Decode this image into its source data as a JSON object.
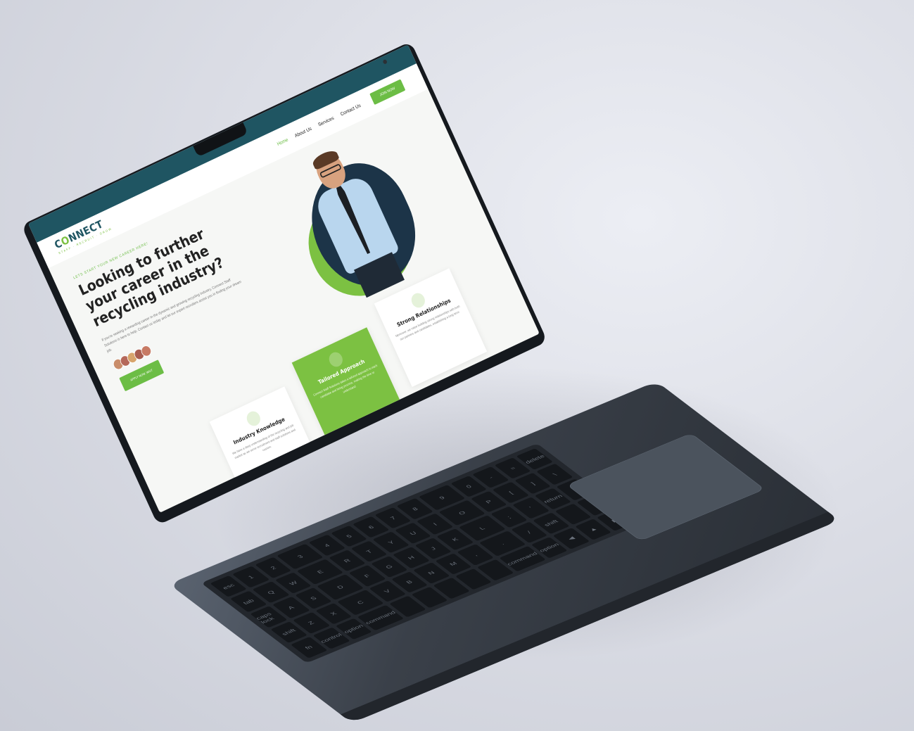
{
  "brand": {
    "name_prefix": "C",
    "name_o": "O",
    "name_suffix": "NNECT",
    "tagline": "STAFF · RECRUIT · GROW"
  },
  "nav": {
    "items": [
      {
        "label": "Home",
        "active": true
      },
      {
        "label": "About Us",
        "active": false
      },
      {
        "label": "Services",
        "active": false
      },
      {
        "label": "Contact Us",
        "active": false
      }
    ],
    "cta": "JOIN NOW"
  },
  "hero": {
    "kicker": "LETS START YOUR NEW CAREER HERE!",
    "title": "Looking to further your career in the recycling industry?",
    "body": "If you're seeking a rewarding career in the dynamic and growing recycling industry, Connect Staff Solutions is here to help. Contact us today and let our expert recruiters assist you in finding your dream job.",
    "button": "APPLY NOW, WAIT"
  },
  "cards": [
    {
      "title": "Industry Knowledge",
      "text": "We have a deep understanding of the recycling and job market as we serve recruitment and staff solutions and custom.",
      "accent": false
    },
    {
      "title": "Tailored Approach",
      "text": "Connect Staff Solutions takes a tailored approach to each candidate and hiring process, making the time to understand",
      "accent": true
    },
    {
      "title": "Strong Relationships",
      "text": "Moreover, we value building strong relationships with both our partners and candidates, establishing a long-term",
      "accent": false
    }
  ],
  "keyboard": {
    "keys": [
      "esc",
      "1",
      "2",
      "3",
      "4",
      "5",
      "6",
      "7",
      "8",
      "9",
      "0",
      "-",
      "=",
      "delete",
      "tab",
      "Q",
      "W",
      "E",
      "R",
      "T",
      "Y",
      "U",
      "I",
      "O",
      "P",
      "[",
      "]",
      "\\",
      "caps lock",
      "A",
      "S",
      "D",
      "F",
      "G",
      "H",
      "J",
      "K",
      "L",
      ";",
      "'",
      "return",
      "",
      "shift",
      "Z",
      "X",
      "C",
      "V",
      "B",
      "N",
      "M",
      ",",
      ".",
      "/",
      "shift",
      "",
      "",
      "fn",
      "control",
      "option",
      "command",
      "",
      "",
      "",
      "",
      "",
      "command",
      "option",
      "◀",
      "▲",
      "▶"
    ]
  },
  "colors": {
    "teal": "#1f5562",
    "green": "#6cbd45",
    "navy": "#1c3448"
  }
}
